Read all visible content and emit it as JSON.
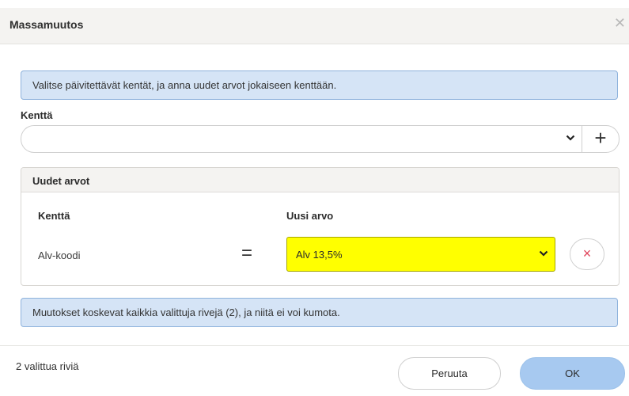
{
  "dialog": {
    "title": "Massamuutos",
    "close_icon": "close-icon"
  },
  "info_top": "Valitse päivitettävät kentät, ja anna uudet arvot jokaiseen kenttään.",
  "field_selector": {
    "label": "Kenttä",
    "value": "",
    "chevron_icon": "chevron-down-icon",
    "add_symbol": "+"
  },
  "new_values": {
    "title": "Uudet arvot",
    "col_field": "Kenttä",
    "col_value": "Uusi arvo",
    "rows": [
      {
        "field": "Alv-koodi",
        "operator": "=",
        "value": "Alv 13,5%",
        "highlight_color": "#ffff00",
        "remove_symbol": "×"
      }
    ]
  },
  "info_bottom": "Muutokset koskevat kaikkia valittuja rivejä (2), ja niitä ei voi kumota.",
  "footer": {
    "selected_count": "2 valittua riviä",
    "cancel_label": "Peruuta",
    "ok_label": "OK"
  },
  "colors": {
    "info_bg": "#d5e4f6",
    "ok_bg": "#a7c9f0",
    "remove_icon": "#e0445a"
  }
}
